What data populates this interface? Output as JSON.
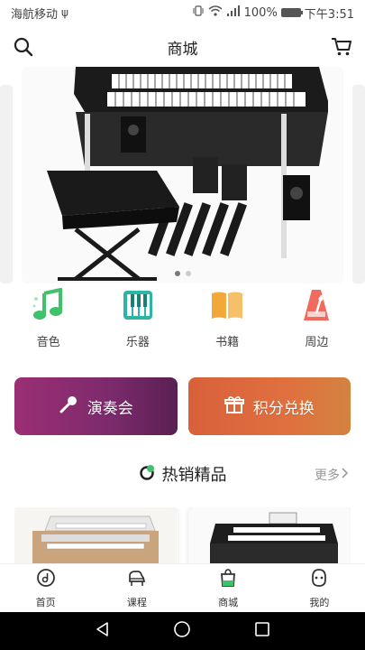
{
  "status_bar": {
    "carrier": "海航移动",
    "battery": "100%",
    "battery_level": 1.0,
    "time": "下午3:51"
  },
  "header": {
    "title": "商城"
  },
  "banner": {
    "page_count": 2,
    "active_index": 0
  },
  "categories": [
    {
      "label": "音色",
      "icon": "music-note-icon",
      "color": "#3ec26a"
    },
    {
      "label": "乐器",
      "icon": "piano-keys-icon",
      "color": "#2db4a4"
    },
    {
      "label": "书籍",
      "icon": "book-icon",
      "color": "#f3a93a"
    },
    {
      "label": "周边",
      "icon": "metronome-icon",
      "color": "#f06a5e"
    }
  ],
  "promos": [
    {
      "label": "演奏会",
      "icon": "microphone-icon"
    },
    {
      "label": "积分兑换",
      "icon": "gift-icon"
    }
  ],
  "section": {
    "title": "热销精品",
    "more_label": "更多"
  },
  "tabs": [
    {
      "label": "首页",
      "icon": "home-disc-icon"
    },
    {
      "label": "课程",
      "icon": "grand-piano-icon"
    },
    {
      "label": "商城",
      "icon": "shopping-bag-icon",
      "active": true
    },
    {
      "label": "我的",
      "icon": "profile-icon"
    }
  ],
  "colors": {
    "accent": "#3ec26a",
    "concert_bg": "#8a2c70",
    "points_bg": "#dd6a3d"
  }
}
